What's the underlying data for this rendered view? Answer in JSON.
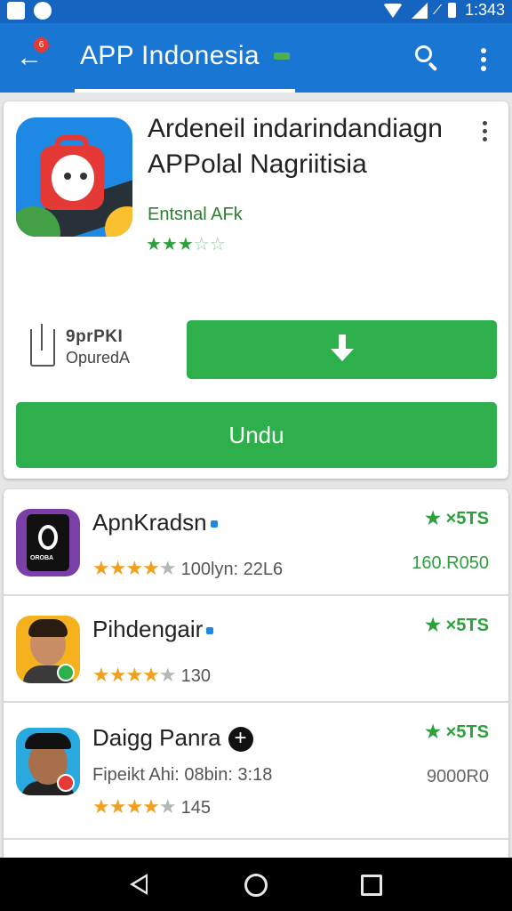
{
  "status_bar": {
    "time": "1:343"
  },
  "app_bar": {
    "title": "APP Indonesia",
    "notification_count": "6"
  },
  "app_detail": {
    "title_line_1": "Ardeneil indarindandiagn",
    "title_line_2": "APPolal Nagriitisia",
    "developer": "Entsnal AFk",
    "stars": "★★★☆☆",
    "rating_line_1": "9prPKI",
    "rating_line_2": "OpuredA",
    "install_label": "Undu"
  },
  "related_apps": [
    {
      "name": "ApnKradsn",
      "stars": "★★★★",
      "stars_empty": "★",
      "meta": "100lyn: 22L6",
      "right_top": "★ ×5TS",
      "right_bottom": "160.R050"
    },
    {
      "name": "Pihdengair",
      "stars": "★★★★",
      "stars_empty": "★",
      "meta": "130",
      "right_top": "★ ×5TS",
      "right_bottom": ""
    },
    {
      "name": "Daigg Panra",
      "sub": "Fipeikt Ahi:  08bin: 3:18",
      "stars": "★★★★",
      "stars_empty": "★",
      "meta": "145",
      "right_top": "★ ×5TS",
      "right_bottom": "9000R0"
    }
  ],
  "avatar_1_brand": "OROBA",
  "colors": {
    "primary": "#1976d2",
    "status_bar": "#1565c0",
    "accent_green": "#2db04b",
    "star_orange": "#f0a020"
  },
  "icons": [
    "back-arrow-icon",
    "search-icon",
    "more-vert-icon",
    "download-icon",
    "plus-icon",
    "nav-back-icon",
    "nav-home-icon",
    "nav-recent-icon"
  ]
}
